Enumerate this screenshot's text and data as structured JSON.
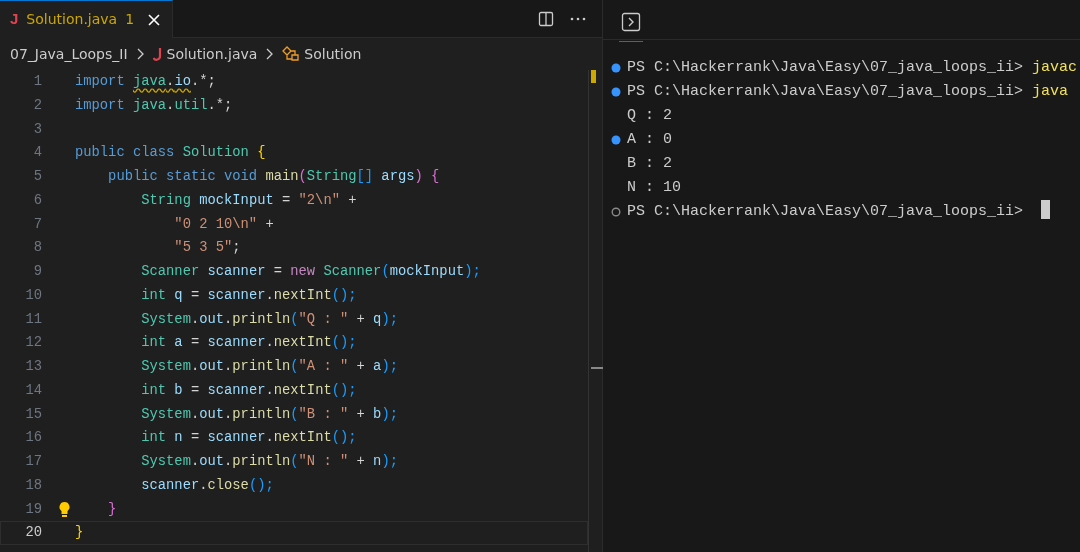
{
  "editor": {
    "tab": {
      "file_icon": "J",
      "label": "Solution.java",
      "problems": "1",
      "selected": true
    },
    "breadcrumbs": [
      {
        "label": "07_Java_Loops_II",
        "kind": "folder"
      },
      {
        "label": "Solution.java",
        "kind": "java"
      },
      {
        "label": "Solution",
        "kind": "class"
      }
    ],
    "lines": [
      {
        "number": "1",
        "current": false,
        "tokens": [
          {
            "text": "import ",
            "kind": "k"
          },
          {
            "text": "java",
            "kind": "t",
            "warning": true
          },
          {
            "text": ".",
            "kind": "p",
            "warning": true
          },
          {
            "text": "io",
            "kind": "v",
            "warning": true
          },
          {
            "text": ".*;",
            "kind": "p"
          }
        ]
      },
      {
        "number": "2",
        "current": false,
        "tokens": [
          {
            "text": "import ",
            "kind": "k"
          },
          {
            "text": "java",
            "kind": "t"
          },
          {
            "text": ".",
            "kind": "p"
          },
          {
            "text": "util",
            "kind": "t"
          },
          {
            "text": ".*;",
            "kind": "p"
          }
        ]
      },
      {
        "number": "3",
        "current": false
      },
      {
        "number": "4",
        "current": false,
        "tokens": [
          {
            "text": "public class ",
            "kind": "k"
          },
          {
            "text": "Solution ",
            "kind": "t"
          },
          {
            "text": "{",
            "kind": "b1"
          }
        ]
      },
      {
        "number": "5",
        "current": false,
        "tokens": [
          {
            "text": "    public static void ",
            "kind": "k"
          },
          {
            "text": "main",
            "kind": "f"
          },
          {
            "text": "(",
            "kind": "b2"
          },
          {
            "text": "String",
            "kind": "t"
          },
          {
            "text": "[]",
            "kind": "b3"
          },
          {
            "text": " args",
            "kind": "v"
          },
          {
            "text": ") ",
            "kind": "b2"
          },
          {
            "text": "{",
            "kind": "b2"
          }
        ]
      },
      {
        "number": "6",
        "current": false,
        "tokens": [
          {
            "text": "        String ",
            "kind": "t"
          },
          {
            "text": "mockInput",
            "kind": "v"
          },
          {
            "text": " = ",
            "kind": "p"
          },
          {
            "text": "\"2\\n\"",
            "kind": "s"
          },
          {
            "text": " +",
            "kind": "p"
          }
        ]
      },
      {
        "number": "7",
        "current": false,
        "tokens": [
          {
            "text": "            \"0 2 10\\n\"",
            "kind": "s"
          },
          {
            "text": " +",
            "kind": "p"
          }
        ]
      },
      {
        "number": "8",
        "current": false,
        "tokens": [
          {
            "text": "            \"5 3 5\"",
            "kind": "s"
          },
          {
            "text": ";",
            "kind": "p"
          }
        ]
      },
      {
        "number": "9",
        "current": false,
        "tokens": [
          {
            "text": "        Scanner ",
            "kind": "t"
          },
          {
            "text": "scanner",
            "kind": "v"
          },
          {
            "text": " = ",
            "kind": "p"
          },
          {
            "text": "new ",
            "kind": "c"
          },
          {
            "text": "Scanner",
            "kind": "t"
          },
          {
            "text": "(",
            "kind": "b3"
          },
          {
            "text": "mockInput",
            "kind": "v"
          },
          {
            "text": ");",
            "kind": "b3"
          }
        ]
      },
      {
        "number": "10",
        "current": false,
        "tokens": [
          {
            "text": "        int ",
            "kind": "t"
          },
          {
            "text": "q",
            "kind": "v"
          },
          {
            "text": " = ",
            "kind": "p"
          },
          {
            "text": "scanner",
            "kind": "v"
          },
          {
            "text": ".",
            "kind": "p"
          },
          {
            "text": "nextInt",
            "kind": "f"
          },
          {
            "text": "();",
            "kind": "b3"
          }
        ]
      },
      {
        "number": "11",
        "current": false,
        "tokens": [
          {
            "text": "        System",
            "kind": "t"
          },
          {
            "text": ".",
            "kind": "p"
          },
          {
            "text": "out",
            "kind": "v"
          },
          {
            "text": ".",
            "kind": "p"
          },
          {
            "text": "println",
            "kind": "f"
          },
          {
            "text": "(",
            "kind": "b3"
          },
          {
            "text": "\"Q : \"",
            "kind": "s"
          },
          {
            "text": " + ",
            "kind": "p"
          },
          {
            "text": "q",
            "kind": "v"
          },
          {
            "text": ");",
            "kind": "b3"
          }
        ]
      },
      {
        "number": "12",
        "current": false,
        "tokens": [
          {
            "text": "        int ",
            "kind": "t"
          },
          {
            "text": "a",
            "kind": "v"
          },
          {
            "text": " = ",
            "kind": "p"
          },
          {
            "text": "scanner",
            "kind": "v"
          },
          {
            "text": ".",
            "kind": "p"
          },
          {
            "text": "nextInt",
            "kind": "f"
          },
          {
            "text": "();",
            "kind": "b3"
          }
        ]
      },
      {
        "number": "13",
        "current": false,
        "tokens": [
          {
            "text": "        System",
            "kind": "t"
          },
          {
            "text": ".",
            "kind": "p"
          },
          {
            "text": "out",
            "kind": "v"
          },
          {
            "text": ".",
            "kind": "p"
          },
          {
            "text": "println",
            "kind": "f"
          },
          {
            "text": "(",
            "kind": "b3"
          },
          {
            "text": "\"A : \"",
            "kind": "s"
          },
          {
            "text": " + ",
            "kind": "p"
          },
          {
            "text": "a",
            "kind": "v"
          },
          {
            "text": ");",
            "kind": "b3"
          }
        ]
      },
      {
        "number": "14",
        "current": false,
        "tokens": [
          {
            "text": "        int ",
            "kind": "t"
          },
          {
            "text": "b",
            "kind": "v"
          },
          {
            "text": " = ",
            "kind": "p"
          },
          {
            "text": "scanner",
            "kind": "v"
          },
          {
            "text": ".",
            "kind": "p"
          },
          {
            "text": "nextInt",
            "kind": "f"
          },
          {
            "text": "();",
            "kind": "b3"
          }
        ]
      },
      {
        "number": "15",
        "current": false,
        "tokens": [
          {
            "text": "        System",
            "kind": "t"
          },
          {
            "text": ".",
            "kind": "p"
          },
          {
            "text": "out",
            "kind": "v"
          },
          {
            "text": ".",
            "kind": "p"
          },
          {
            "text": "println",
            "kind": "f"
          },
          {
            "text": "(",
            "kind": "b3"
          },
          {
            "text": "\"B : \"",
            "kind": "s"
          },
          {
            "text": " + ",
            "kind": "p"
          },
          {
            "text": "b",
            "kind": "v"
          },
          {
            "text": ");",
            "kind": "b3"
          }
        ]
      },
      {
        "number": "16",
        "current": false,
        "tokens": [
          {
            "text": "        int ",
            "kind": "t"
          },
          {
            "text": "n",
            "kind": "v"
          },
          {
            "text": " = ",
            "kind": "p"
          },
          {
            "text": "scanner",
            "kind": "v"
          },
          {
            "text": ".",
            "kind": "p"
          },
          {
            "text": "nextInt",
            "kind": "f"
          },
          {
            "text": "();",
            "kind": "b3"
          }
        ]
      },
      {
        "number": "17",
        "current": false,
        "tokens": [
          {
            "text": "        System",
            "kind": "t"
          },
          {
            "text": ".",
            "kind": "p"
          },
          {
            "text": "out",
            "kind": "v"
          },
          {
            "text": ".",
            "kind": "p"
          },
          {
            "text": "println",
            "kind": "f"
          },
          {
            "text": "(",
            "kind": "b3"
          },
          {
            "text": "\"N : \"",
            "kind": "s"
          },
          {
            "text": " + ",
            "kind": "p"
          },
          {
            "text": "n",
            "kind": "v"
          },
          {
            "text": ");",
            "kind": "b3"
          }
        ]
      },
      {
        "number": "18",
        "current": false,
        "tokens": [
          {
            "text": "        scanner",
            "kind": "v"
          },
          {
            "text": ".",
            "kind": "p"
          },
          {
            "text": "close",
            "kind": "f"
          },
          {
            "text": "();",
            "kind": "b3"
          }
        ]
      },
      {
        "number": "19",
        "current": false,
        "lightbulb": true,
        "tokens": [
          {
            "text": "    }",
            "kind": "b2"
          }
        ]
      },
      {
        "number": "20",
        "current": true,
        "tokens": [
          {
            "text": "}",
            "kind": "b1"
          }
        ]
      }
    ]
  },
  "terminal": {
    "lines": [
      {
        "kind": "success",
        "prompt": "PS C:\\Hackerrank\\Java\\Easy\\07_java_loops_ii>",
        "command": "javac"
      },
      {
        "kind": "success",
        "prompt": "PS C:\\Hackerrank\\Java\\Easy\\07_java_loops_ii>",
        "command": "java"
      },
      {
        "kind": "plain",
        "output": "Q : 2"
      },
      {
        "kind": "success",
        "output": "A : 0"
      },
      {
        "kind": "plain",
        "output": "B : 2"
      },
      {
        "kind": "plain",
        "output": "N : 10"
      },
      {
        "kind": "pending",
        "prompt": "PS C:\\Hackerrank\\Java\\Easy\\07_java_loops_ii>",
        "cursor": true
      }
    ]
  }
}
